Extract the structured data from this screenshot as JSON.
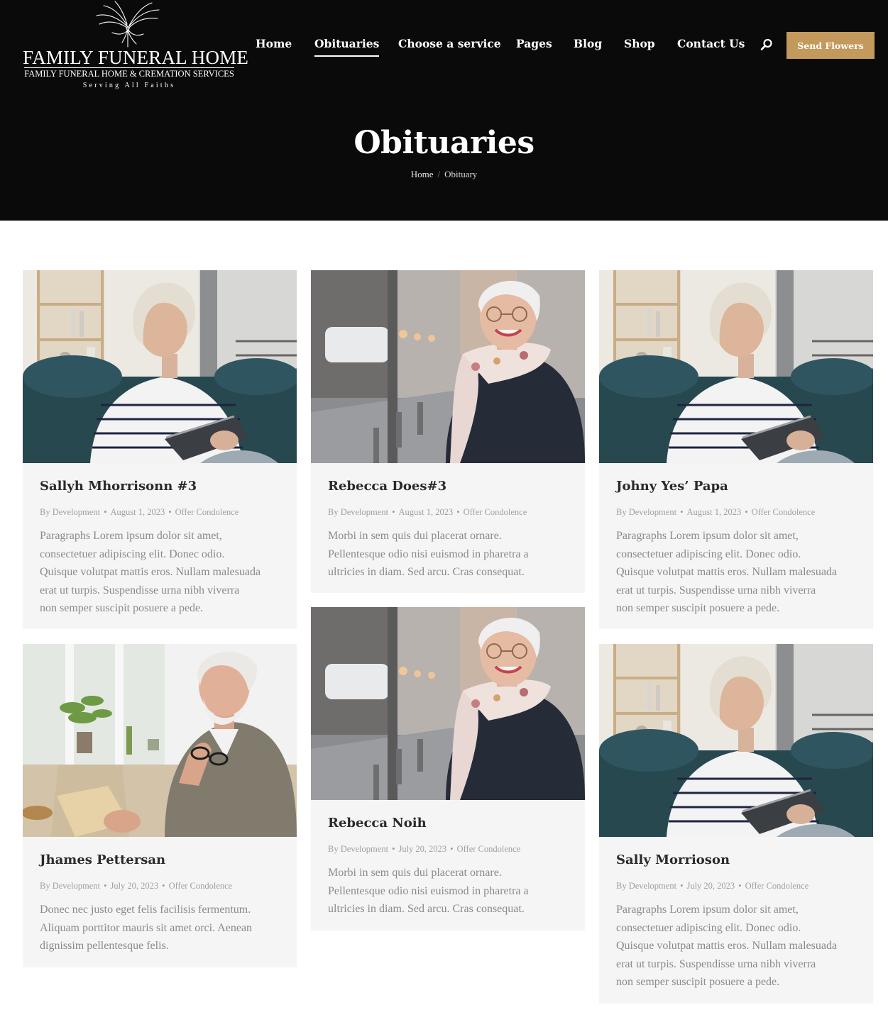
{
  "brand": {
    "title": "FAMILY FUNERAL HOME",
    "subtitle": "FAMILY FUNERAL HOME & CREMATION SERVICES",
    "tagline": "Serving All Faiths"
  },
  "nav": {
    "items": [
      {
        "label": "Home",
        "active": false
      },
      {
        "label": "Obituaries",
        "active": true
      },
      {
        "label": "Choose a service",
        "active": false
      },
      {
        "label": "Pages",
        "active": false
      },
      {
        "label": "Blog",
        "active": false
      },
      {
        "label": "Shop",
        "active": false
      },
      {
        "label": "Contact Us",
        "active": false
      }
    ],
    "search_icon": "search-icon",
    "cta_label": "Send Flowers"
  },
  "hero": {
    "title": "Obituaries",
    "breadcrumb": [
      "Home",
      "Obituary"
    ],
    "breadcrumb_sep": "/"
  },
  "colors": {
    "header_bg": "#0a0a0b",
    "accent": "#c39a5b",
    "card_bg": "#f5f5f5"
  },
  "posts": [
    {
      "title": "Sallyh Mhorrisonn #3",
      "author": "By Development",
      "date": "August 1, 2023",
      "action": "Offer Condolence",
      "photo": "woman-on-sofa-with-tablet",
      "excerpt_lines": [
        "Paragraphs Lorem ipsum dolor sit amet,",
        "consectetuer adipiscing elit. Donec odio.",
        "Quisque volutpat mattis eros. Nullam malesuada",
        "erat ut turpis. Suspendisse urna nibh viverra",
        "non semper suscipit posuere a pede."
      ]
    },
    {
      "title": "Rebecca Does#3",
      "author": "By Development",
      "date": "August 1, 2023",
      "action": "Offer Condolence",
      "photo": "smiling-woman-on-street",
      "excerpt_lines": [
        "Morbi in sem quis dui placerat ornare.",
        "Pellentesque odio nisi euismod in pharetra a",
        "ultricies in diam. Sed arcu. Cras consequat."
      ]
    },
    {
      "title": "Johny Yes’ Papa",
      "author": "By Development",
      "date": "August 1, 2023",
      "action": "Offer Condolence",
      "photo": "woman-on-sofa-with-tablet",
      "excerpt_lines": [
        "Paragraphs Lorem ipsum dolor sit amet,",
        "consectetuer adipiscing elit. Donec odio.",
        "Quisque volutpat mattis eros. Nullam malesuada",
        "erat ut turpis. Suspendisse urna nibh viverra",
        "non semper suscipit posuere a pede."
      ]
    },
    {
      "title": "Jhames Pettersan",
      "author": "By Development",
      "date": "July 20, 2023",
      "action": "Offer Condolence",
      "photo": "older-man-reading-with-glasses",
      "excerpt_lines": [
        "Donec nec justo eget felis facilisis fermentum.",
        "Aliquam porttitor mauris sit amet orci. Aenean",
        "dignissim pellentesque felis."
      ]
    },
    {
      "title": "Rebecca Noih",
      "author": "By Development",
      "date": "July 20, 2023",
      "action": "Offer Condolence",
      "photo": "smiling-woman-on-street",
      "excerpt_lines": [
        "Morbi in sem quis dui placerat ornare.",
        "Pellentesque odio nisi euismod in pharetra a",
        "ultricies in diam. Sed arcu. Cras consequat."
      ]
    },
    {
      "title": "Sally Morrioson",
      "author": "By Development",
      "date": "July 20, 2023",
      "action": "Offer Condolence",
      "photo": "woman-on-sofa-with-tablet",
      "excerpt_lines": [
        "Paragraphs Lorem ipsum dolor sit amet,",
        "consectetuer adipiscing elit. Donec odio.",
        "Quisque volutpat mattis eros. Nullam malesuada",
        "erat ut turpis. Suspendisse urna nibh viverra",
        "non semper suscipit posuere a pede."
      ]
    }
  ]
}
